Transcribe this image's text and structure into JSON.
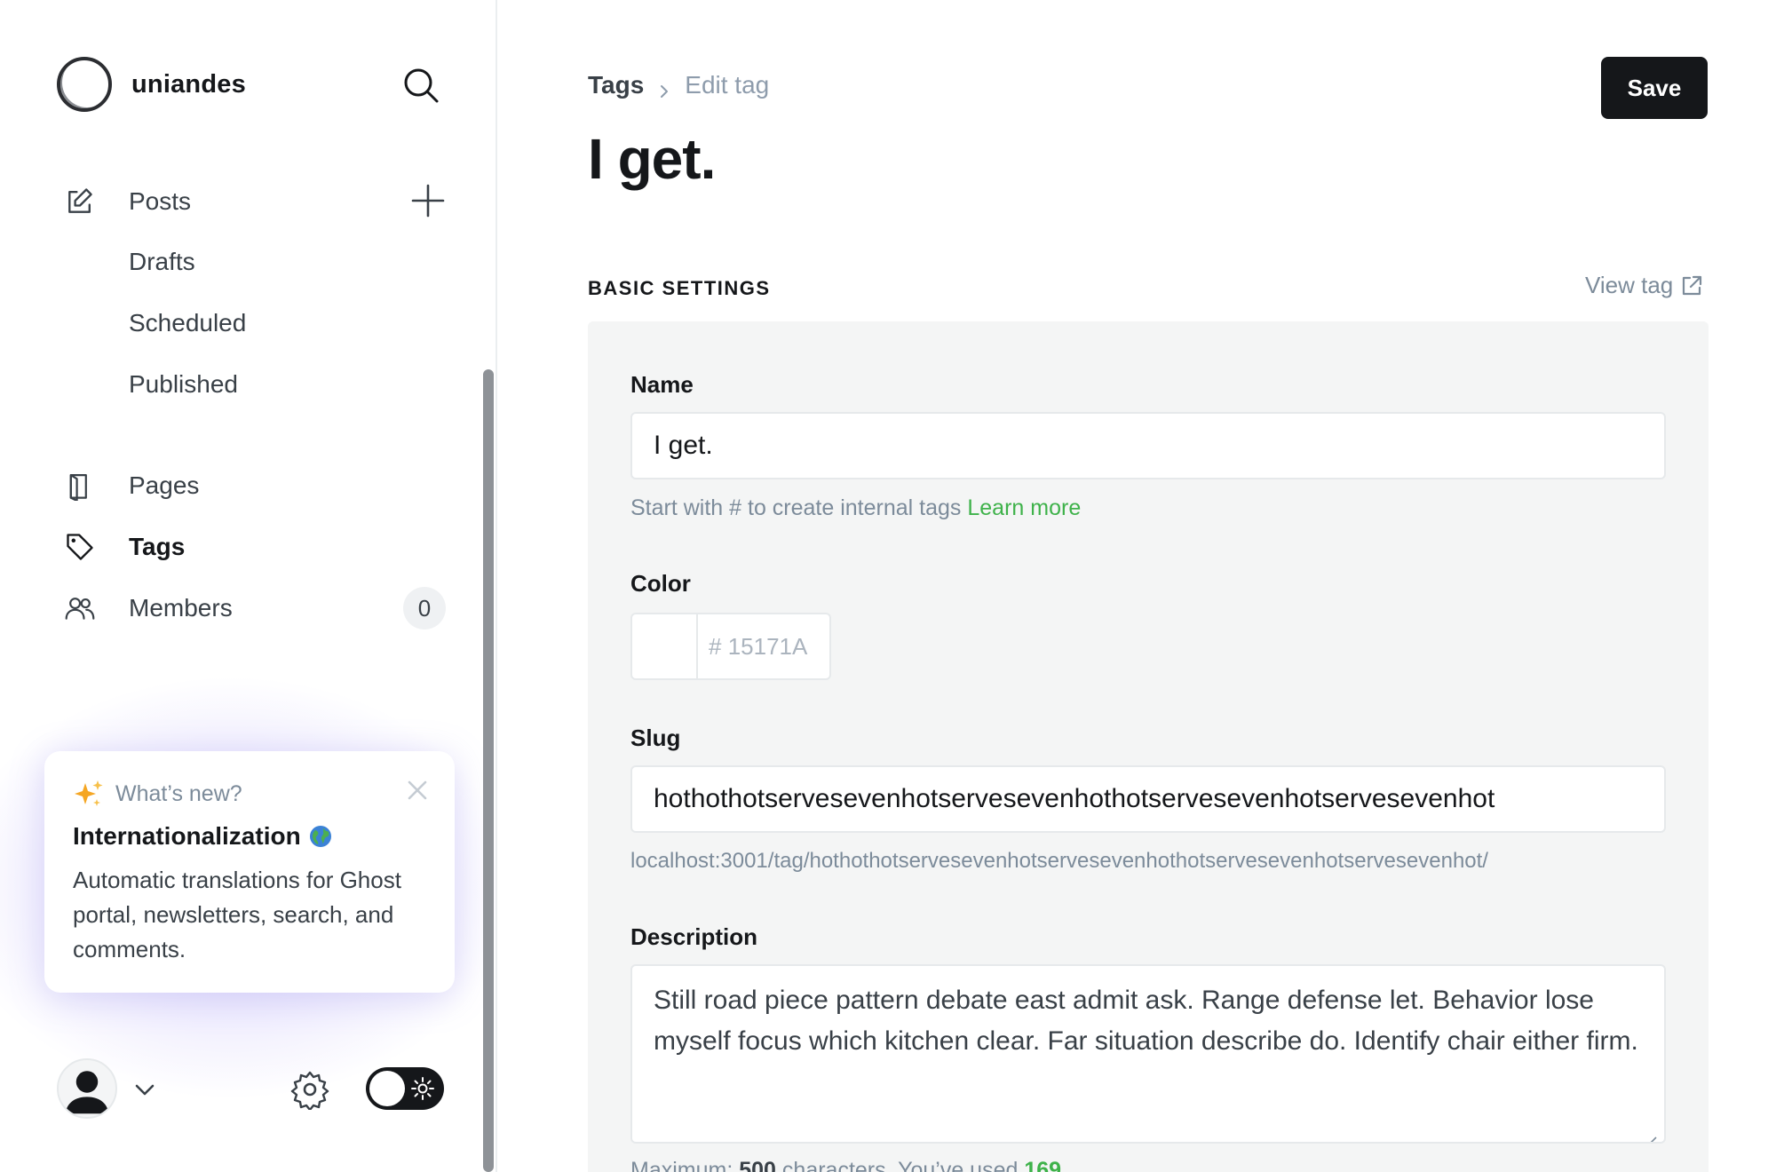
{
  "sidebar": {
    "site_name": "uniandes",
    "nav": {
      "posts": "Posts",
      "drafts": "Drafts",
      "scheduled": "Scheduled",
      "published": "Published",
      "pages": "Pages",
      "tags": "Tags",
      "members": "Members",
      "members_count": "0"
    },
    "whats_new": {
      "heading": "What’s new?",
      "title": "Internationalization",
      "body": "Automatic translations for Ghost portal, newsletters, search, and comments."
    }
  },
  "header": {
    "breadcrumb_root": "Tags",
    "breadcrumb_current": "Edit tag",
    "title": "I get.",
    "save_label": "Save"
  },
  "basic_settings": {
    "heading": "BASIC SETTINGS",
    "view_tag": "View tag",
    "name": {
      "label": "Name",
      "value": "I get.",
      "hint": "Start with # to create internal tags",
      "hint_link": "Learn more"
    },
    "color": {
      "label": "Color",
      "prefix": "#",
      "placeholder": "15171A"
    },
    "slug": {
      "label": "Slug",
      "value": "hothothotservesevenhotservesevenhothotservesevenhotservesevenhot",
      "url": "localhost:3001/tag/hothothotservesevenhotservesevenhothotservesevenhotservesevenhot/"
    },
    "description": {
      "label": "Description",
      "value": "Still road piece pattern debate east admit ask. Range defense let. Behavior lose myself focus which kitchen clear. Far situation describe do. Identify chair either firm.",
      "max_label": "Maximum:",
      "max_value": "500",
      "used_label": "characters. You’ve used",
      "used_value": "169"
    }
  },
  "colors": {
    "accent_green": "#3eb24a",
    "dark": "#15171a"
  }
}
